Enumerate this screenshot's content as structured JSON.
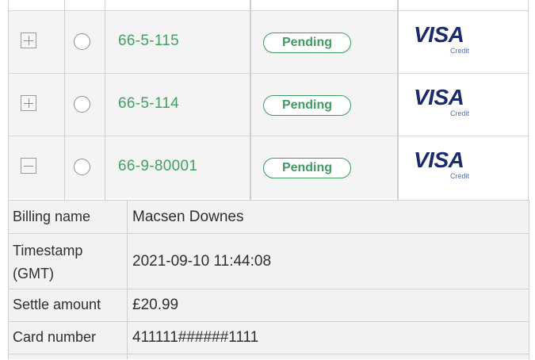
{
  "transactions": [
    {
      "expand_symbol": "+",
      "id": "66-5-115",
      "status": "Pending",
      "card_brand": "VISA",
      "card_type": "Credit",
      "expanded": false
    },
    {
      "expand_symbol": "+",
      "id": "66-5-114",
      "status": "Pending",
      "card_brand": "VISA",
      "card_type": "Credit",
      "expanded": false
    },
    {
      "expand_symbol": "−",
      "id": "66-9-80001",
      "status": "Pending",
      "card_brand": "VISA",
      "card_type": "Credit",
      "expanded": true
    }
  ],
  "details": {
    "billing_name_label": "Billing name",
    "billing_name_value": "Macsen Downes",
    "timestamp_label_1": "Timestamp",
    "timestamp_label_2": "(GMT)",
    "timestamp_value": "2021-09-10 11:44:08",
    "settle_amount_label": "Settle amount",
    "settle_amount_value": "£20.99",
    "card_number_label": "Card number",
    "card_number_value": "411111######1111"
  },
  "colors": {
    "accent_green": "#3fa162",
    "visa_blue": "#1a2a6c",
    "cell_bg": "#f4f4f4"
  }
}
